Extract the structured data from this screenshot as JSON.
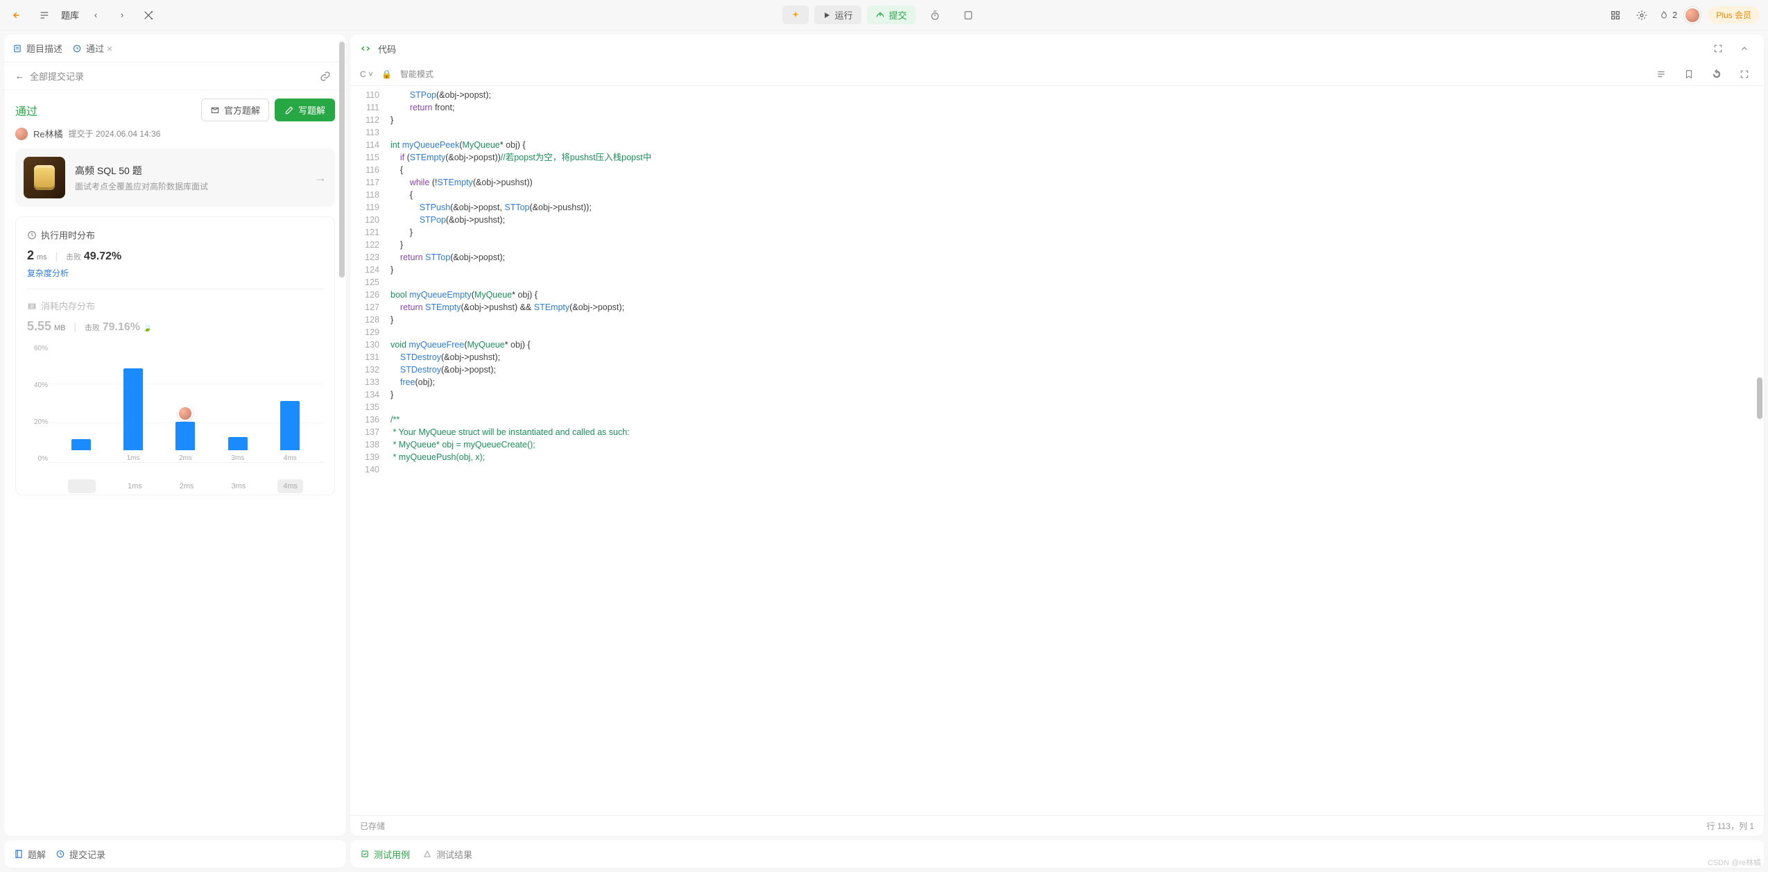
{
  "topbar": {
    "title": "题库",
    "run": "运行",
    "submit": "提交",
    "flame_count": "2",
    "plus": "Plus 会员"
  },
  "left": {
    "tabs": {
      "desc": "题目描述",
      "history": "通过"
    },
    "back_label": "全部提交记录",
    "pass": "通过",
    "user": "Re林橘",
    "submitted_at": "提交于 2024.06.04 14:36",
    "official_solution": "官方题解",
    "write_solution": "写题解",
    "promo": {
      "title": "高频 SQL 50 题",
      "sub": "面试考点全覆盖应对高阶数据库面试"
    },
    "runtime": {
      "header": "执行用时分布",
      "value": "2",
      "unit": "ms",
      "beat_label": "击败",
      "beat_pct": "49.72%",
      "complexity_link": "复杂度分析"
    },
    "memory": {
      "header": "消耗内存分布",
      "value": "5.55",
      "unit": "MB",
      "beat_label": "击败",
      "beat_pct": "79.16%"
    },
    "bottom": {
      "solution": "题解",
      "submissions": "提交记录"
    }
  },
  "chart_data": {
    "type": "bar",
    "ylabel": "percent",
    "ylim": [
      0,
      62
    ],
    "yticks": [
      "60%",
      "40%",
      "20%",
      "0%"
    ],
    "categories": [
      "1ms",
      "2ms",
      "3ms",
      "4ms"
    ],
    "values": [
      43,
      15,
      7,
      26
    ],
    "marker_category": "2ms",
    "leading_bar_pct": 6,
    "selector": [
      "",
      "1ms",
      "2ms",
      "3ms",
      "4ms"
    ]
  },
  "code": {
    "title": "代码",
    "lang": "C",
    "mode": "智能模式",
    "status_left": "已存储",
    "status_right": "行 113，列 1",
    "start_line": 110,
    "lines": [
      [
        [
          "        ",
          ""
        ],
        [
          "STPop",
          "fn"
        ],
        [
          "(&",
          ""
        ],
        [
          "obj",
          "pr"
        ],
        [
          "->",
          ""
        ],
        [
          "popst",
          "pr"
        ],
        [
          ");",
          ""
        ]
      ],
      [
        [
          "        ",
          ""
        ],
        [
          "return",
          "kw"
        ],
        [
          " ",
          ""
        ],
        [
          "front",
          "pr"
        ],
        [
          ";",
          ""
        ]
      ],
      [
        [
          "}",
          ""
        ]
      ],
      [
        [
          "",
          ""
        ]
      ],
      [
        [
          "int",
          "ty"
        ],
        [
          " ",
          ""
        ],
        [
          "myQueuePeek",
          "fn"
        ],
        [
          "(",
          ""
        ],
        [
          "MyQueue",
          "ty"
        ],
        [
          "* ",
          ""
        ],
        [
          "obj",
          "pr"
        ],
        [
          ") {",
          ""
        ]
      ],
      [
        [
          "    ",
          ""
        ],
        [
          "if",
          "kw"
        ],
        [
          " (",
          ""
        ],
        [
          "STEmpty",
          "fn"
        ],
        [
          "(&",
          ""
        ],
        [
          "obj",
          "pr"
        ],
        [
          "->",
          ""
        ],
        [
          "popst",
          "pr"
        ],
        [
          "))",
          ""
        ],
        [
          "//若popst为空，将pushst压入栈popst中",
          "cm"
        ]
      ],
      [
        [
          "    {",
          ""
        ]
      ],
      [
        [
          "        ",
          ""
        ],
        [
          "while",
          "kw"
        ],
        [
          " (!",
          ""
        ],
        [
          "STEmpty",
          "fn"
        ],
        [
          "(&",
          ""
        ],
        [
          "obj",
          "pr"
        ],
        [
          "->",
          ""
        ],
        [
          "pushst",
          "pr"
        ],
        [
          "))",
          ""
        ]
      ],
      [
        [
          "        {",
          ""
        ]
      ],
      [
        [
          "            ",
          ""
        ],
        [
          "STPush",
          "fn"
        ],
        [
          "(&",
          ""
        ],
        [
          "obj",
          "pr"
        ],
        [
          "->",
          ""
        ],
        [
          "popst",
          "pr"
        ],
        [
          ", ",
          ""
        ],
        [
          "STTop",
          "fn"
        ],
        [
          "(&",
          ""
        ],
        [
          "obj",
          "pr"
        ],
        [
          "->",
          ""
        ],
        [
          "pushst",
          "pr"
        ],
        [
          "));",
          ""
        ]
      ],
      [
        [
          "            ",
          ""
        ],
        [
          "STPop",
          "fn"
        ],
        [
          "(&",
          ""
        ],
        [
          "obj",
          "pr"
        ],
        [
          "->",
          ""
        ],
        [
          "pushst",
          "pr"
        ],
        [
          ");",
          ""
        ]
      ],
      [
        [
          "        }",
          ""
        ]
      ],
      [
        [
          "    }",
          ""
        ]
      ],
      [
        [
          "    ",
          ""
        ],
        [
          "return",
          "kw"
        ],
        [
          " ",
          ""
        ],
        [
          "STTop",
          "fn"
        ],
        [
          "(&",
          ""
        ],
        [
          "obj",
          "pr"
        ],
        [
          "->",
          ""
        ],
        [
          "popst",
          "pr"
        ],
        [
          ");",
          ""
        ]
      ],
      [
        [
          "}",
          ""
        ]
      ],
      [
        [
          "",
          ""
        ]
      ],
      [
        [
          "bool",
          "ty"
        ],
        [
          " ",
          ""
        ],
        [
          "myQueueEmpty",
          "fn"
        ],
        [
          "(",
          ""
        ],
        [
          "MyQueue",
          "ty"
        ],
        [
          "* ",
          ""
        ],
        [
          "obj",
          "pr"
        ],
        [
          ") {",
          ""
        ]
      ],
      [
        [
          "    ",
          ""
        ],
        [
          "return",
          "kw"
        ],
        [
          " ",
          ""
        ],
        [
          "STEmpty",
          "fn"
        ],
        [
          "(&",
          ""
        ],
        [
          "obj",
          "pr"
        ],
        [
          "->",
          ""
        ],
        [
          "pushst",
          "pr"
        ],
        [
          ") && ",
          ""
        ],
        [
          "STEmpty",
          "fn"
        ],
        [
          "(&",
          ""
        ],
        [
          "obj",
          "pr"
        ],
        [
          "->",
          ""
        ],
        [
          "popst",
          "pr"
        ],
        [
          ");",
          ""
        ]
      ],
      [
        [
          "}",
          ""
        ]
      ],
      [
        [
          "",
          ""
        ]
      ],
      [
        [
          "void",
          "ty"
        ],
        [
          " ",
          ""
        ],
        [
          "myQueueFree",
          "fn"
        ],
        [
          "(",
          ""
        ],
        [
          "MyQueue",
          "ty"
        ],
        [
          "* ",
          ""
        ],
        [
          "obj",
          "pr"
        ],
        [
          ") {",
          ""
        ]
      ],
      [
        [
          "    ",
          ""
        ],
        [
          "STDestroy",
          "fn"
        ],
        [
          "(&",
          ""
        ],
        [
          "obj",
          "pr"
        ],
        [
          "->",
          ""
        ],
        [
          "pushst",
          "pr"
        ],
        [
          ");",
          ""
        ]
      ],
      [
        [
          "    ",
          ""
        ],
        [
          "STDestroy",
          "fn"
        ],
        [
          "(&",
          ""
        ],
        [
          "obj",
          "pr"
        ],
        [
          "->",
          ""
        ],
        [
          "popst",
          "pr"
        ],
        [
          ");",
          ""
        ]
      ],
      [
        [
          "    ",
          ""
        ],
        [
          "free",
          "fn"
        ],
        [
          "(",
          ""
        ],
        [
          "obj",
          "pr"
        ],
        [
          ");",
          ""
        ]
      ],
      [
        [
          "}",
          ""
        ]
      ],
      [
        [
          "",
          ""
        ]
      ],
      [
        [
          "/**",
          "cm"
        ]
      ],
      [
        [
          " * Your MyQueue struct will be instantiated and called as such:",
          "cm"
        ]
      ],
      [
        [
          " * MyQueue* obj = myQueueCreate();",
          "cm"
        ]
      ],
      [
        [
          " * myQueuePush(obj, x);",
          "cm"
        ]
      ],
      [
        [
          "",
          ""
        ]
      ]
    ]
  },
  "bottom_tabs": {
    "testcase": "测试用例",
    "testresult": "测试结果"
  },
  "watermark": "CSDN @re林橘"
}
